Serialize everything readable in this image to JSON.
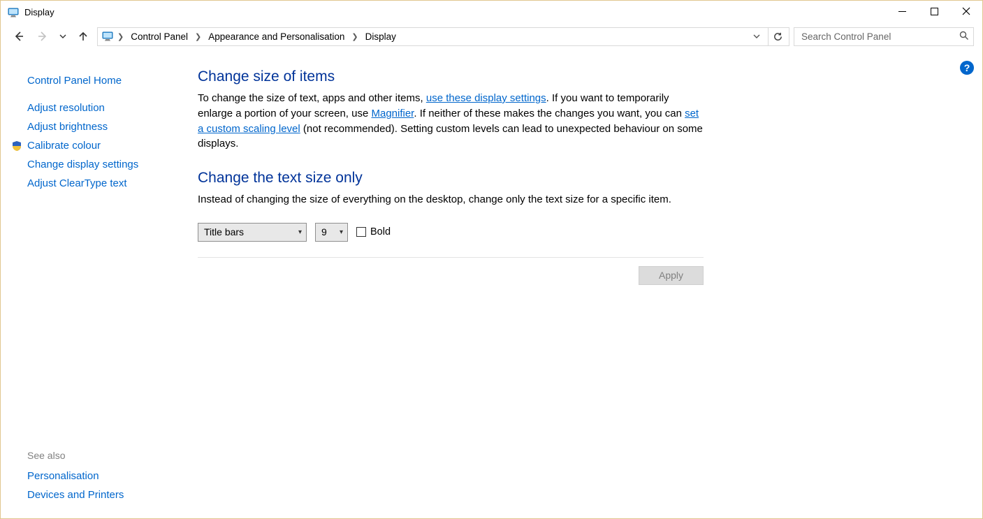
{
  "window": {
    "title": "Display"
  },
  "breadcrumb": {
    "root": "Control Panel",
    "mid": "Appearance and Personalisation",
    "leaf": "Display"
  },
  "search": {
    "placeholder": "Search Control Panel"
  },
  "sidebar": {
    "home": "Control Panel Home",
    "links": [
      "Adjust resolution",
      "Adjust brightness",
      "Calibrate colour",
      "Change display settings",
      "Adjust ClearType text"
    ],
    "seealso_heading": "See also",
    "seealso": [
      "Personalisation",
      "Devices and Printers"
    ]
  },
  "section1": {
    "heading": "Change size of items",
    "t1": "To change the size of text, apps and other items, ",
    "link1": "use these display settings",
    "t2": ". If you want to temporarily enlarge a portion of your screen, use ",
    "link2": "Magnifier",
    "t3": ". If neither of these makes the changes you want, you can ",
    "link3": "set a custom scaling level",
    "t4": " (not recommended). Setting custom levels can lead to unexpected behaviour on some displays."
  },
  "section2": {
    "heading": "Change the text size only",
    "para": "Instead of changing the size of everything on the desktop, change only the text size for a specific item.",
    "item_select": "Title bars",
    "size_select": "9",
    "bold_label": "Bold",
    "apply": "Apply"
  }
}
